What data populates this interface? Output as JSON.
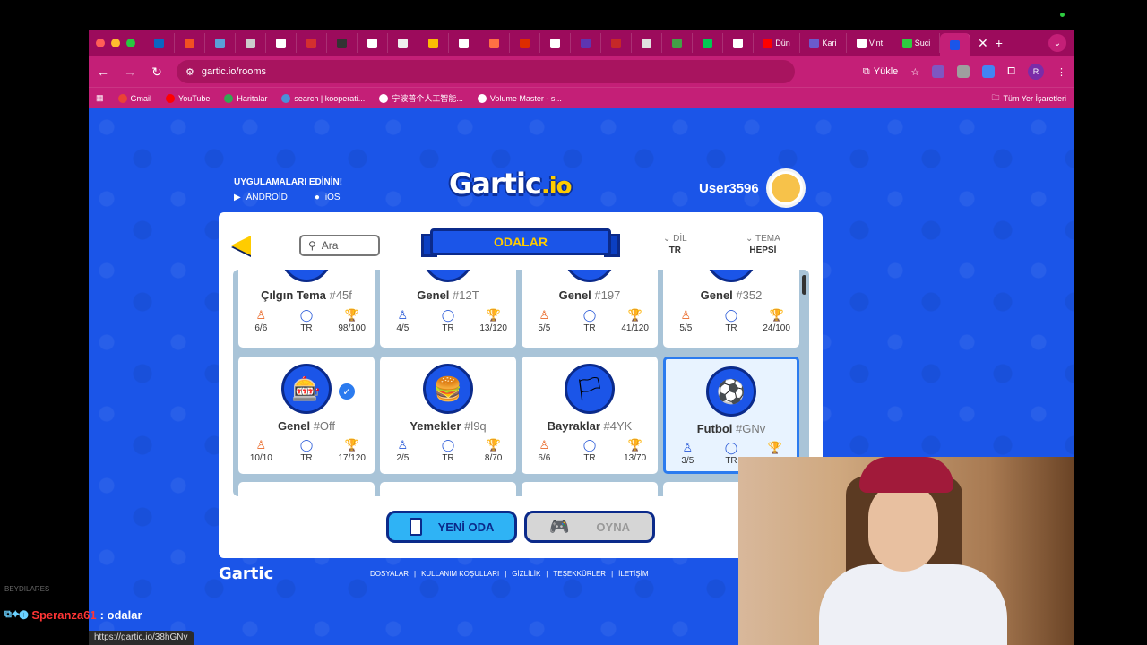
{
  "browser": {
    "tabs": [
      {
        "label": "",
        "color": "#0a66c2",
        "wide": false
      },
      {
        "label": "",
        "color": "#f25022",
        "wide": false
      },
      {
        "label": "",
        "color": "#5aa0d8",
        "wide": false
      },
      {
        "label": "",
        "color": "#cccccc",
        "wide": false
      },
      {
        "label": "",
        "color": "#ffffff",
        "wide": false
      },
      {
        "label": "",
        "color": "#d32f2f",
        "wide": false
      },
      {
        "label": "",
        "color": "#333333",
        "wide": false
      },
      {
        "label": "",
        "color": "#ffffff",
        "wide": false
      },
      {
        "label": "",
        "color": "#eeeeee",
        "wide": false
      },
      {
        "label": "",
        "color": "#fbbc04",
        "wide": false
      },
      {
        "label": "",
        "color": "#ffffff",
        "wide": false
      },
      {
        "label": "",
        "color": "#ff7043",
        "wide": false
      },
      {
        "label": "",
        "color": "#dd2c00",
        "wide": false
      },
      {
        "label": "",
        "color": "#ffffff",
        "wide": false
      },
      {
        "label": "",
        "color": "#5e35b1",
        "wide": false
      },
      {
        "label": "",
        "color": "#c62828",
        "wide": false
      },
      {
        "label": "",
        "color": "#e0e0e0",
        "wide": false
      },
      {
        "label": "",
        "color": "#43a047",
        "wide": false
      },
      {
        "label": "",
        "color": "#00c853",
        "wide": false
      },
      {
        "label": "",
        "color": "#ffffff",
        "wide": false
      },
      {
        "label": "Dün",
        "color": "#ff0000",
        "wide": true
      },
      {
        "label": "Kari",
        "color": "#6a5acd",
        "wide": true
      },
      {
        "label": "Vint",
        "color": "#ffffff",
        "wide": true
      },
      {
        "label": "Suci",
        "color": "#2ecc40",
        "wide": true
      },
      {
        "label": "",
        "color": "#1b55e8",
        "wide": false,
        "active": true
      }
    ],
    "url": "gartic.io/rooms",
    "install_label": "Yükle",
    "profile_initial": "R",
    "bookmarks": [
      {
        "label": "Gmail",
        "color": "#ea4335"
      },
      {
        "label": "YouTube",
        "color": "#ff0000"
      },
      {
        "label": "Haritalar",
        "color": "#34a853"
      },
      {
        "label": "search | kooperati...",
        "color": "#4a90d9"
      },
      {
        "label": "宁波普个人工智能...",
        "color": "#ffffff"
      },
      {
        "label": "Volume Master - s...",
        "color": "#ffffff"
      }
    ],
    "bookmarks_all": "Tüm Yer İşaretleri",
    "status_url": "https://gartic.io/38hGNv"
  },
  "page": {
    "apps_title": "UYGULAMALARI EDİNİN!",
    "android_label": "ANDROİD",
    "ios_label": "iOS",
    "logo_main": "Gartic",
    "logo_suffix": ".io",
    "username": "User3596",
    "search_placeholder": "Ara",
    "title": "ODALAR",
    "language_label": "DİL",
    "language_value": "TR",
    "theme_label": "TEMA",
    "theme_value": "HEPSİ",
    "new_room_label": "YENİ ODA",
    "play_label": "OYNA",
    "footer_logo": "Gartic",
    "footer_links": [
      "DOSYALAR",
      "KULLANIM KOŞULLARI",
      "GİZLİLİK",
      "TEŞEKKÜRLER",
      "İLETİŞİM"
    ]
  },
  "rooms": [
    {
      "name": "Çılgın Tema",
      "code": "#45f",
      "players": "6/6",
      "lang": "TR",
      "points": "98/100",
      "full": true,
      "icon": "🎨"
    },
    {
      "name": "Genel",
      "code": "#12T",
      "players": "4/5",
      "lang": "TR",
      "points": "13/120",
      "full": false,
      "icon": "🎰"
    },
    {
      "name": "Genel",
      "code": "#197",
      "players": "5/5",
      "lang": "TR",
      "points": "41/120",
      "full": true,
      "icon": "🎰"
    },
    {
      "name": "Genel",
      "code": "#352",
      "players": "5/5",
      "lang": "TR",
      "points": "24/100",
      "full": true,
      "icon": "🎰"
    },
    {
      "name": "Genel",
      "code": "#Off",
      "players": "10/10",
      "lang": "TR",
      "points": "17/120",
      "full": true,
      "icon": "🎰",
      "checked": true
    },
    {
      "name": "Yemekler",
      "code": "#l9q",
      "players": "2/5",
      "lang": "TR",
      "points": "8/70",
      "full": false,
      "icon": "🍔"
    },
    {
      "name": "Bayraklar",
      "code": "#4YK",
      "players": "6/6",
      "lang": "TR",
      "points": "13/70",
      "full": true,
      "icon": "🏳"
    },
    {
      "name": "Futbol",
      "code": "#GNv",
      "players": "3/5",
      "lang": "TR",
      "points": "",
      "full": false,
      "icon": "⚽",
      "selected": true
    }
  ],
  "overlay": {
    "faded_text": "BEYDILARES",
    "chat_nick": "Speranza61",
    "chat_message": ": odalar"
  }
}
